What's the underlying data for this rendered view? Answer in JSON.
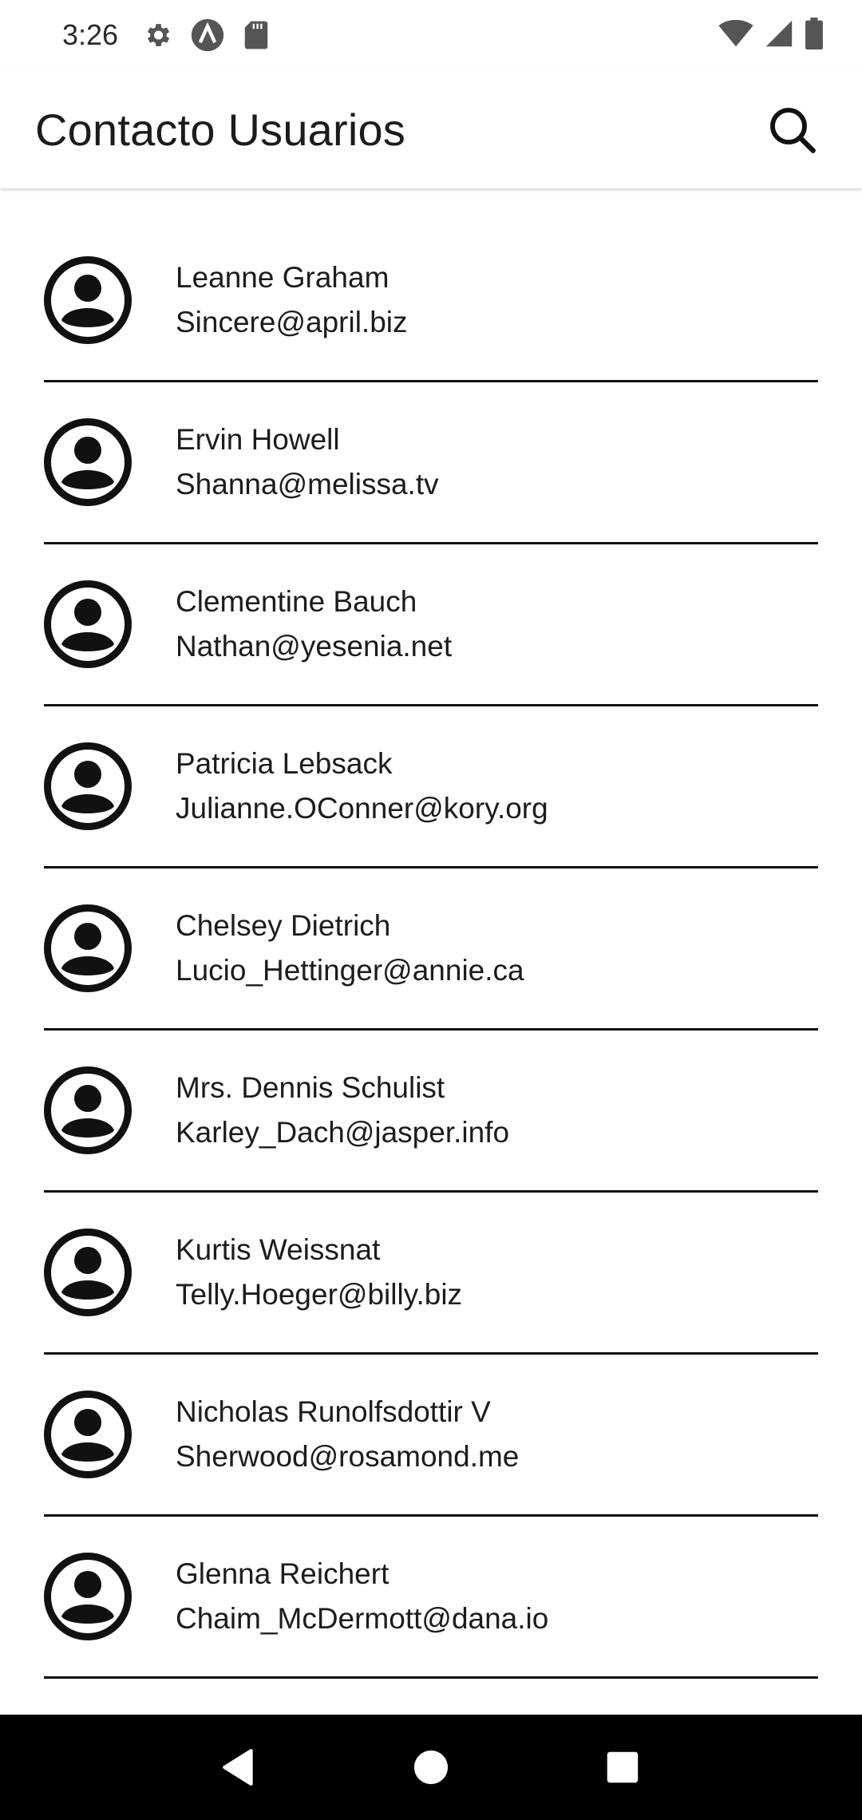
{
  "status_bar": {
    "time": "3:26",
    "left_icons": [
      "settings-icon",
      "a-circle-icon",
      "sd-card-icon"
    ],
    "right_icons": [
      "wifi-icon",
      "cell-signal-icon",
      "battery-icon"
    ]
  },
  "app_bar": {
    "title": "Contacto Usuarios",
    "search_icon": "search-icon"
  },
  "contacts": [
    {
      "name": "Leanne Graham",
      "email": "Sincere@april.biz"
    },
    {
      "name": "Ervin Howell",
      "email": "Shanna@melissa.tv"
    },
    {
      "name": "Clementine Bauch",
      "email": "Nathan@yesenia.net"
    },
    {
      "name": "Patricia Lebsack",
      "email": "Julianne.OConner@kory.org"
    },
    {
      "name": "Chelsey Dietrich",
      "email": "Lucio_Hettinger@annie.ca"
    },
    {
      "name": "Mrs. Dennis Schulist",
      "email": "Karley_Dach@jasper.info"
    },
    {
      "name": "Kurtis Weissnat",
      "email": "Telly.Hoeger@billy.biz"
    },
    {
      "name": "Nicholas Runolfsdottir V",
      "email": "Sherwood@rosamond.me"
    },
    {
      "name": "Glenna Reichert",
      "email": "Chaim_McDermott@dana.io"
    }
  ],
  "nav_bar": {
    "buttons": [
      "back-icon",
      "home-icon",
      "recents-icon"
    ]
  },
  "colors": {
    "text": "#1c1c1c",
    "divider": "#111111",
    "nav_background": "#000000",
    "background": "#ffffff"
  }
}
